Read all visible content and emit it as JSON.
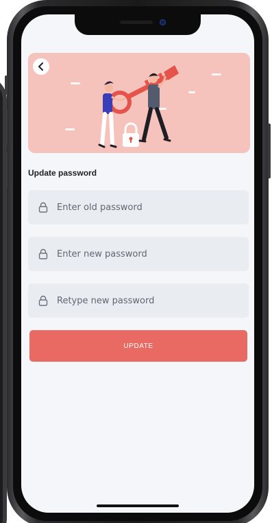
{
  "screen": {
    "section_title": "Update password",
    "fields": [
      {
        "placeholder": "Enter old password",
        "value": ""
      },
      {
        "placeholder": "Enter new password",
        "value": ""
      },
      {
        "placeholder": "Retype new password",
        "value": ""
      }
    ],
    "update_button_label": "UPDATE"
  },
  "icons": {
    "back": "chevron-left-icon",
    "field": "lock-icon"
  },
  "colors": {
    "accent": "#e86a63",
    "hero_bg": "#f6c3bc",
    "field_bg": "#e9ecf1",
    "screen_bg": "#f4f6f9"
  }
}
